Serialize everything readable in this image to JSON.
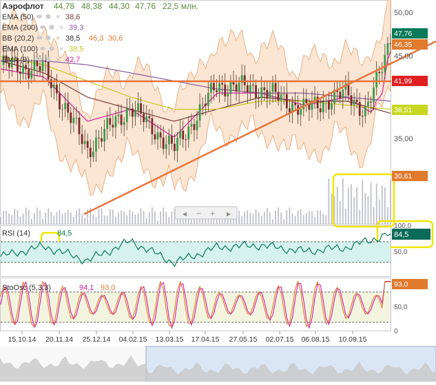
{
  "header": {
    "ticker": "Аэрофлот",
    "ohlc": [
      "44,78",
      "48,38",
      "44,30",
      "47,76"
    ],
    "volume": "22,5 млн."
  },
  "indicators": [
    {
      "label": "EMA (50)",
      "value": "38,6",
      "color": "#7b3b3b"
    },
    {
      "label": "EMA (200)",
      "value": "39,3",
      "color": "#8a5aa0"
    },
    {
      "label": "BB (20,2)",
      "value": "38,5",
      "extra": [
        "46,3",
        "30,6"
      ],
      "color": "#333333",
      "extra_color": "#e07b2e"
    },
    {
      "label": "EMA (100)",
      "value": "38,5",
      "color": "#c8c820"
    },
    {
      "label": "EMA (9)",
      "value": "42,7",
      "color": "#d020a0"
    }
  ],
  "price_axis": {
    "ticks": [
      "50,00",
      "45,00",
      "35,00"
    ],
    "badges": [
      {
        "text": "47,76",
        "bg": "#0a7a5a"
      },
      {
        "text": "46,35",
        "bg": "#e07b2e"
      },
      {
        "text": "41,99",
        "bg": "#e02020"
      },
      {
        "text": "38,51",
        "bg": "#c8d820"
      },
      {
        "text": "30,61",
        "bg": "#e07b2e"
      }
    ]
  },
  "nav_buttons": [
    "◄",
    "−",
    "+",
    "►"
  ],
  "rsi": {
    "label": "RSI (14)",
    "value": "84,5",
    "ticks": [
      "100,0",
      "50,0"
    ],
    "badge": "84,5",
    "color": "#0a7a5a"
  },
  "stoch": {
    "label": "StoOsc (5,3,3)",
    "k": "94,1",
    "d": "93,0",
    "ticks": [
      "50,0",
      "0"
    ],
    "badge": "93,0",
    "k_color": "#d020a0",
    "d_color": "#e07b2e"
  },
  "x_axis": [
    "15.10.14",
    "20.11.14",
    "25.12.14",
    "04.02.15",
    "13.03.15",
    "17.04.15",
    "27.05.15",
    "02.07.15",
    "06.08.15",
    "10.09.15"
  ],
  "chart_data": [
    {
      "type": "line",
      "title": "Аэрофлот",
      "x": [
        "15.10.14",
        "20.11.14",
        "25.12.14",
        "04.02.15",
        "13.03.15",
        "17.04.15",
        "27.05.15",
        "02.07.15",
        "06.08.15",
        "10.09.15"
      ],
      "series": [
        {
          "name": "Аэрофлот",
          "values": [
            44.0,
            43.5,
            33.5,
            38.8,
            33.5,
            41.5,
            41.0,
            38.5,
            40.5,
            35.0
          ]
        },
        {
          "name": "EMA (9)",
          "values": [
            43.5,
            42.5,
            37.0,
            38.5,
            35.0,
            40.5,
            40.5,
            39.0,
            40.0,
            36.5
          ]
        },
        {
          "name": "EMA (50)",
          "values": [
            44.5,
            43.0,
            40.0,
            38.5,
            37.0,
            38.5,
            40.0,
            39.5,
            39.5,
            38.0
          ]
        },
        {
          "name": "EMA (100)",
          "values": [
            45.0,
            44.0,
            42.0,
            40.0,
            38.5,
            38.5,
            39.5,
            39.5,
            39.0,
            38.5
          ]
        },
        {
          "name": "EMA (200)",
          "values": [
            44.5,
            44.5,
            44.0,
            43.0,
            42.0,
            41.0,
            40.5,
            40.5,
            40.0,
            39.5
          ]
        }
      ],
      "last": {
        "close": 47.76,
        "bb_upper": 46.35,
        "bb_lower": 30.61,
        "horizontal_level": 41.99,
        "ema100": 38.51
      },
      "y_ticks": [
        50,
        45,
        35
      ],
      "ylim": [
        29.5,
        50.5
      ],
      "grid": false
    },
    {
      "type": "line",
      "title": "RSI (14)",
      "series": [
        {
          "name": "RSI (14)",
          "values": [
            40,
            60,
            32,
            70,
            28,
            58,
            62,
            50,
            58,
            84.5
          ]
        }
      ],
      "ylim": [
        0,
        100
      ],
      "y_ticks": [
        100,
        50
      ]
    },
    {
      "type": "line",
      "title": "StoOsc (5,3,3)",
      "series": [
        {
          "name": "%K",
          "values": [
            30,
            80,
            10,
            85,
            15,
            80,
            75,
            30,
            70,
            94.1
          ]
        },
        {
          "name": "%D",
          "values": [
            35,
            75,
            15,
            80,
            20,
            75,
            70,
            35,
            65,
            93.0
          ]
        }
      ],
      "ylim": [
        0,
        100
      ],
      "y_ticks": [
        50,
        0
      ]
    }
  ]
}
